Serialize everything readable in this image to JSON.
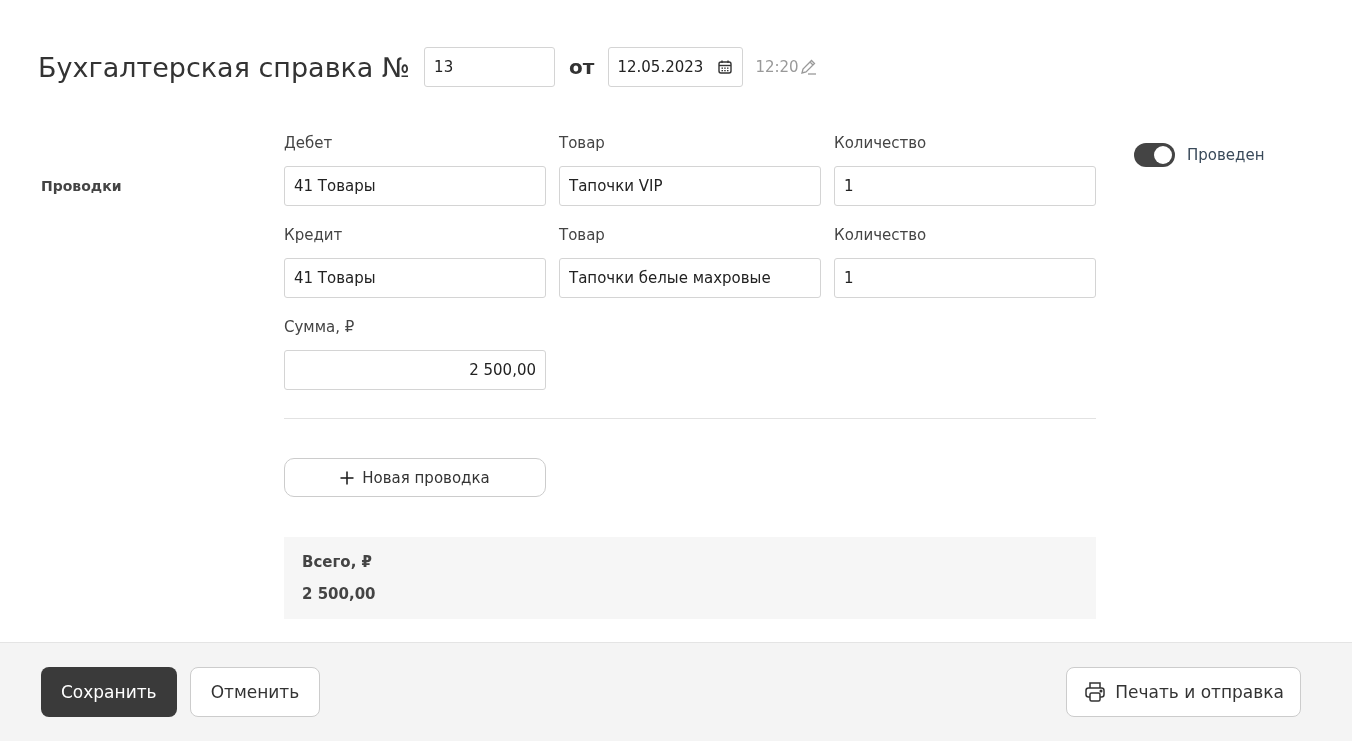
{
  "header": {
    "title": "Бухгалтерская справка №",
    "number": "13",
    "date_label": "от",
    "date": "12.05.2023",
    "time": "12:20"
  },
  "section_label": "Проводки",
  "posted": {
    "label": "Проведен",
    "on": true
  },
  "entry_rows": [
    [
      {
        "label": "Дебет",
        "value": "41 Товары"
      },
      {
        "label": "Товар",
        "value": "Тапочки VIP"
      },
      {
        "label": "Количество",
        "value": "1"
      }
    ],
    [
      {
        "label": "Кредит",
        "value": "41 Товары"
      },
      {
        "label": "Товар",
        "value": "Тапочки белые махровые"
      },
      {
        "label": "Количество",
        "value": "1"
      }
    ]
  ],
  "sum": {
    "label": "Сумма, ₽",
    "value": "2 500,00"
  },
  "add_button": "Новая проводка",
  "total": {
    "label": "Всего, ₽",
    "value": "2 500,00"
  },
  "footer": {
    "buttons": [
      {
        "label": "Сохранить",
        "kind": "primary"
      },
      {
        "label": "Отменить",
        "kind": "secondary"
      }
    ],
    "print_button": "Печать и отправка"
  }
}
